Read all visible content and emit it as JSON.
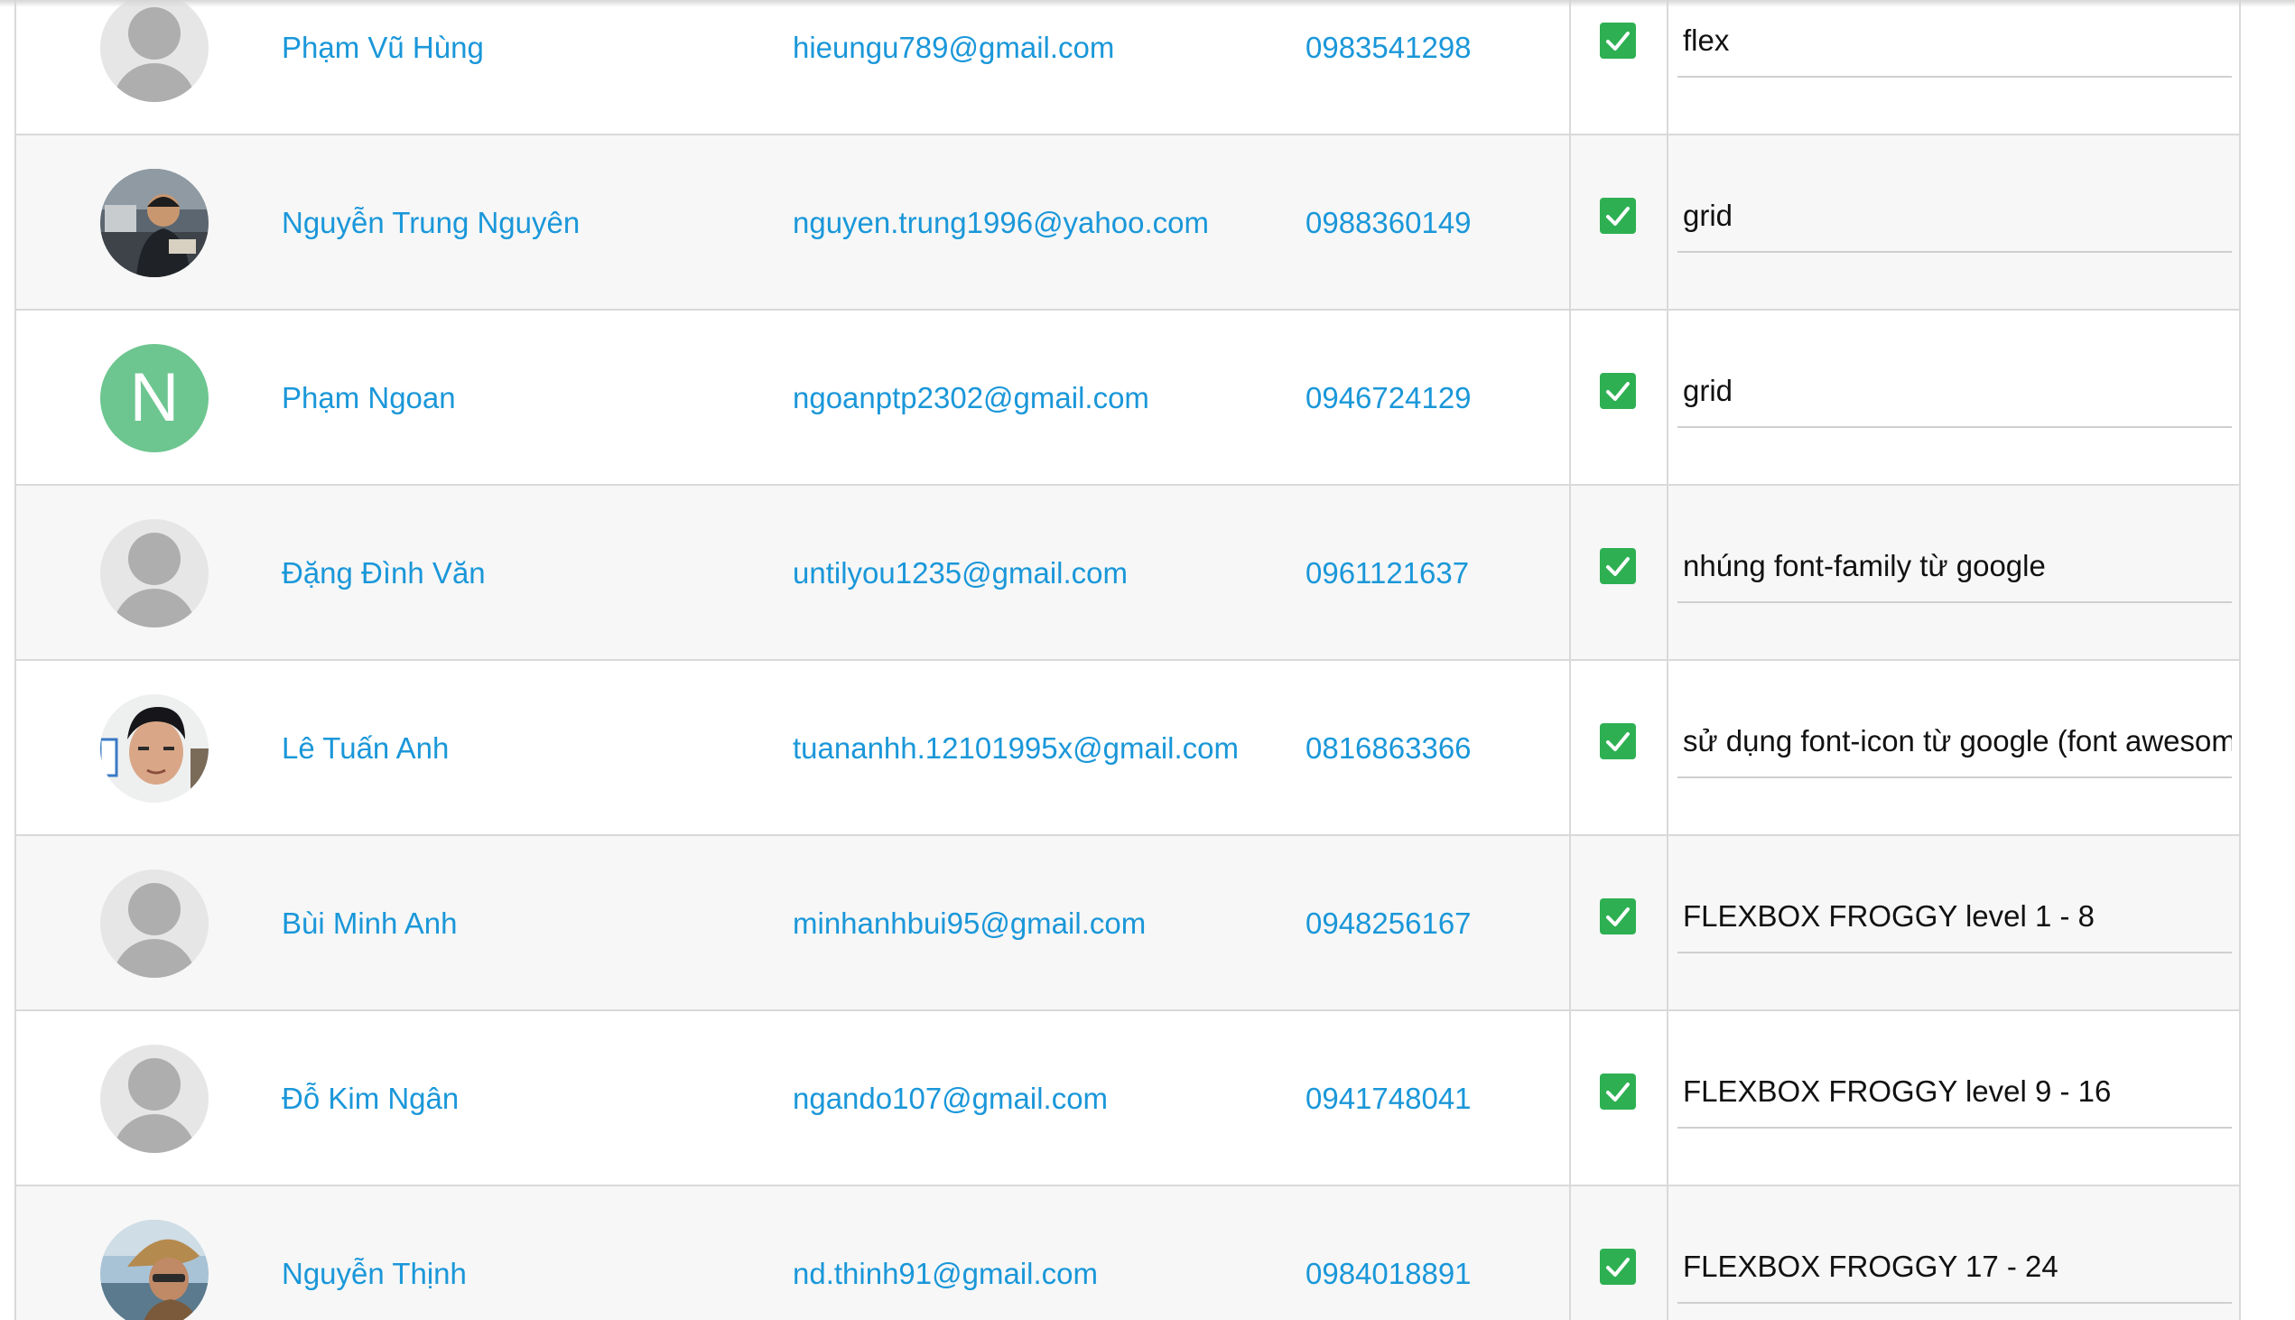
{
  "rows": [
    {
      "avatar": "default-user-icon",
      "name": "Phạm Vũ Hùng",
      "email": "hieungu789@gmail.com",
      "phone": "0983541298",
      "checked": true,
      "note": "flex"
    },
    {
      "avatar": "photo",
      "name": "Nguyễn Trung Nguyên",
      "email": "nguyen.trung1996@yahoo.com",
      "phone": "0988360149",
      "checked": true,
      "note": "grid"
    },
    {
      "avatar": "initial",
      "initial": "N",
      "avatar_color": "#6dc690",
      "name": "Phạm Ngoan",
      "email": "ngoanptp2302@gmail.com",
      "phone": "0946724129",
      "checked": true,
      "note": "grid"
    },
    {
      "avatar": "default-user-icon",
      "name": "Đặng Đình Văn",
      "email": "untilyou1235@gmail.com",
      "phone": "0961121637",
      "checked": true,
      "note": "nhúng font-family từ google"
    },
    {
      "avatar": "photo",
      "name": "Lê Tuấn Anh",
      "email": "tuananhh.12101995x@gmail.com",
      "phone": "0816863366",
      "checked": true,
      "note": "sử dụng font-icon từ google (font awesom"
    },
    {
      "avatar": "default-user-icon",
      "name": "Bùi Minh Anh",
      "email": "minhanhbui95@gmail.com",
      "phone": "0948256167",
      "checked": true,
      "note": "FLEXBOX FROGGY level 1 - 8"
    },
    {
      "avatar": "default-user-icon",
      "name": "Đỗ Kim Ngân",
      "email": "ngando107@gmail.com",
      "phone": "0941748041",
      "checked": true,
      "note": "FLEXBOX FROGGY level 9 - 16"
    },
    {
      "avatar": "photo",
      "name": "Nguyễn Thịnh",
      "email": "nd.thinh91@gmail.com",
      "phone": "0984018891",
      "checked": true,
      "note": "FLEXBOX FROGGY 17 - 24"
    }
  ],
  "colors": {
    "link": "#1a97d9",
    "checkbox": "#2eb052",
    "row_alt": "#f7f7f7",
    "border": "#d9d9d9"
  },
  "icons": {
    "checkbox": "checkmark-icon",
    "default_avatar": "user-silhouette-icon"
  }
}
